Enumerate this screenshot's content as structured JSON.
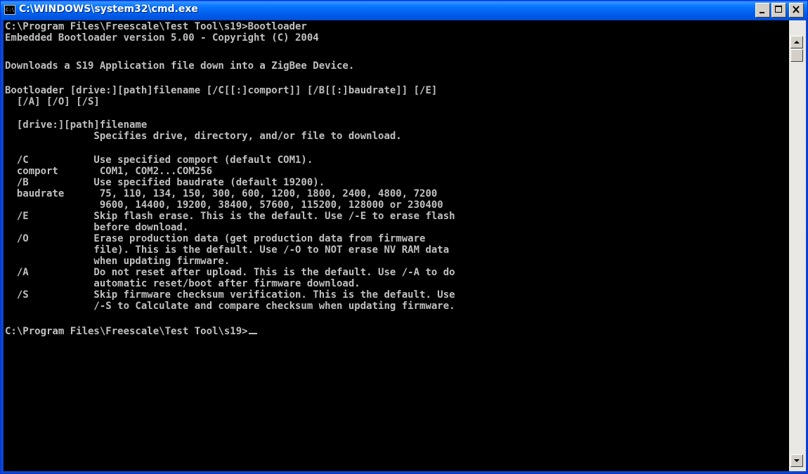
{
  "window": {
    "title": "C:\\WINDOWS\\system32\\cmd.exe",
    "icon_text": "C:\\",
    "icon": "console-icon",
    "controls": [
      "minimize-icon",
      "maximize-icon",
      "close-icon"
    ]
  },
  "console": {
    "lines": [
      "C:\\Program Files\\Freescale\\Test Tool\\s19>Bootloader",
      "Embedded Bootloader version 5.00 - Copyright (C) 2004",
      "",
      "Downloads a S19 Application file down into a ZigBee Device.",
      "",
      "Bootloader [drive:][path]filename [/C[[:]comport]] [/B[[:]baudrate]] [/E]",
      "  [/A] [/O] [/S]",
      "",
      "  [drive:][path]filename",
      "               Specifies drive, directory, and/or file to download.",
      "",
      "  /C           Use specified comport (default COM1).",
      "  comport       COM1, COM2...COM256",
      "  /B           Use specified baudrate (default 19200).",
      "  baudrate      75, 110, 134, 150, 300, 600, 1200, 1800, 2400, 4800, 7200",
      "                9600, 14400, 19200, 38400, 57600, 115200, 128000 or 230400",
      "  /E           Skip flash erase. This is the default. Use /-E to erase flash",
      "               before download.",
      "  /O           Erase production data (get production data from firmware",
      "               file). This is the default. Use /-O to NOT erase NV RAM data",
      "               when updating firmware.",
      "  /A           Do not reset after upload. This is the default. Use /-A to do",
      "               automatic reset/boot after firmware download.",
      "  /S           Skip firmware checksum verification. This is the default. Use",
      "               /-S to Calculate and compare checksum when updating firmware.",
      "",
      "C:\\Program Files\\Freescale\\Test Tool\\s19>"
    ]
  },
  "scrollbar": {
    "up_icon": "arrow-up-icon",
    "down_icon": "arrow-down-icon"
  },
  "colors": {
    "console_bg": "#000000",
    "console_fg": "#c0c0c0",
    "titlebar": "#0054e3"
  }
}
